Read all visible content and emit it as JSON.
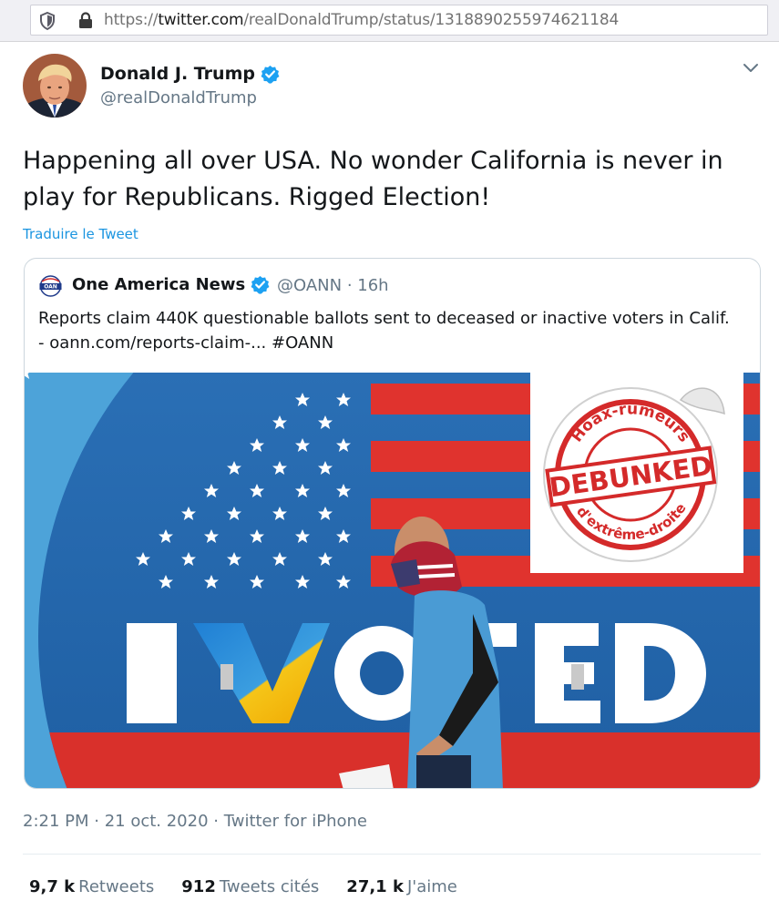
{
  "browser": {
    "url_prefix": "https://",
    "url_host": "twitter.com",
    "url_path": "/realDonaldTrump/status/1318890255974621184"
  },
  "tweet": {
    "author_name": "Donald J. Trump",
    "author_handle": "@realDonaldTrump",
    "text": "Happening all over USA. No wonder California is never in play for Republicans. Rigged Election!",
    "translate_label": "Traduire le Tweet",
    "timestamp": "2:21 PM · 21 oct. 2020 · Twitter for iPhone"
  },
  "quoted": {
    "author_name": "One America News",
    "logo_text": "OAN",
    "meta": "@OANN · 16h",
    "text": "Reports claim 440K questionable ballots sent to deceased or inactive voters in Calif. - oann.com/reports-claim-... #OANN",
    "image_text": "I VOTED"
  },
  "stamp": {
    "top_text": "Hoax-rumeurs",
    "center_text": "DEBUNKED",
    "bottom_text": "d'extrême-droite",
    "color": "#d42a2a"
  },
  "stats": [
    {
      "count": "9,7 k",
      "label": "Retweets"
    },
    {
      "count": "912",
      "label": "Tweets cités"
    },
    {
      "count": "27,1 k",
      "label": "J'aime"
    }
  ],
  "colors": {
    "link": "#1b95e0",
    "verified": "#1da1f2",
    "muted": "#657786"
  }
}
